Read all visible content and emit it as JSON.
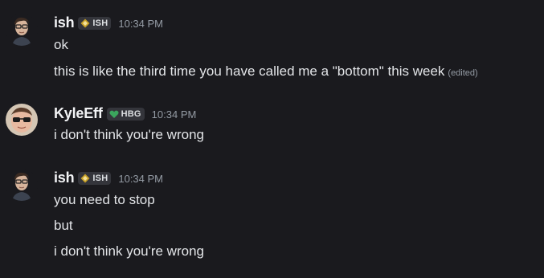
{
  "messages": [
    {
      "author": "ish",
      "tag": "ISH",
      "tag_icon": "gold-diamond-icon",
      "timestamp": "10:34 PM",
      "lines": [
        "ok",
        "this is like the third time you have called me a \"bottom\" this week"
      ],
      "edited_label": "(edited)"
    },
    {
      "author": "KyleEff",
      "tag": "HBG",
      "tag_icon": "green-heart-icon",
      "timestamp": "10:34 PM",
      "lines": [
        "i don't think you're wrong"
      ]
    },
    {
      "author": "ish",
      "tag": "ISH",
      "tag_icon": "gold-diamond-icon",
      "timestamp": "10:34 PM",
      "lines": [
        "you need to stop",
        "but",
        "i don't think you're wrong"
      ]
    }
  ],
  "colors": {
    "background": "#1a1a1e",
    "username": "#f2f3f5",
    "message_text": "#e3e5e8",
    "timestamp": "#949ba4",
    "tag_background": "#34353b",
    "tag_gold": "#c9a227",
    "tag_green": "#3ba55d"
  }
}
